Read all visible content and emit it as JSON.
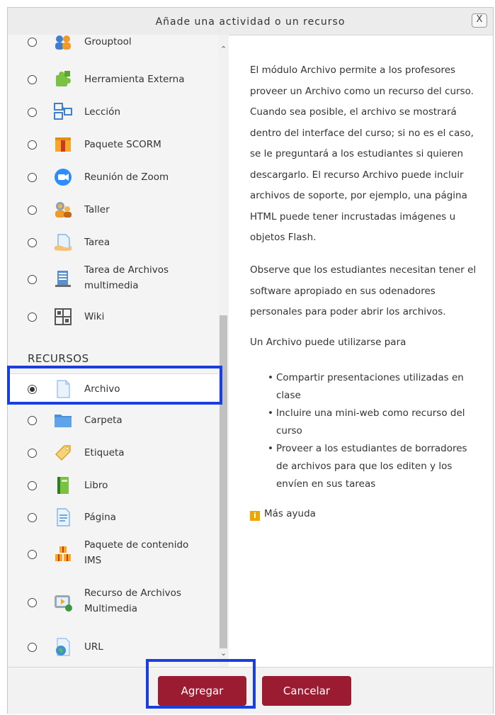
{
  "dialog": {
    "title": "Añade una actividad o un recurso",
    "close_label": "X"
  },
  "activities": [
    {
      "label": "Grouptool",
      "icon": "grouptool-icon"
    },
    {
      "label": "Herramienta Externa",
      "icon": "puzzle-icon"
    },
    {
      "label": "Lección",
      "icon": "lesson-icon"
    },
    {
      "label": "Paquete SCORM",
      "icon": "scorm-package-icon"
    },
    {
      "label": "Reunión de Zoom",
      "icon": "zoom-icon"
    },
    {
      "label": "Taller",
      "icon": "workshop-icon"
    },
    {
      "label": "Tarea",
      "icon": "assignment-icon"
    },
    {
      "label": "Tarea de Archivos multimedia",
      "icon": "media-assignment-icon"
    },
    {
      "label": "Wiki",
      "icon": "wiki-icon"
    }
  ],
  "resources_heading": "RECURSOS",
  "resources": [
    {
      "label": "Archivo",
      "icon": "file-icon",
      "selected": true
    },
    {
      "label": "Carpeta",
      "icon": "folder-icon"
    },
    {
      "label": "Etiqueta",
      "icon": "label-icon"
    },
    {
      "label": "Libro",
      "icon": "book-icon"
    },
    {
      "label": "Página",
      "icon": "page-icon"
    },
    {
      "label": "Paquete de contenido IMS",
      "icon": "ims-package-icon"
    },
    {
      "label": "Recurso de Archivos Multimedia",
      "icon": "media-resource-icon"
    },
    {
      "label": "URL",
      "icon": "url-globe-icon"
    }
  ],
  "description": {
    "p1": "El módulo Archivo permite a los profesores proveer un Archivo como un recurso del curso. Cuando sea posible, el archivo se mostrará dentro del interface del curso; si no es el caso, se le preguntará a los estudiantes si quieren descargarlo. El recurso Archivo puede incluir archivos de soporte, por ejemplo, una página HTML puede tener incrustadas imágenes u objetos Flash.",
    "p2": "Observe que los estudiantes necesitan tener el software apropiado en sus odenadores personales para poder abrir los archivos.",
    "p3": "Un Archivo puede utilizarse para",
    "bullets": [
      "Compartir presentaciones utilizadas en clase",
      "Incluire una mini-web como recurso del curso",
      "Proveer a los estudiantes de borradores de archivos para que los editen y los envíen en sus tareas"
    ],
    "help_label": "Más ayuda",
    "help_icon": "i"
  },
  "footer": {
    "add_label": "Agregar",
    "cancel_label": "Cancelar"
  },
  "colors": {
    "button": "#9b1c31",
    "highlight": "#1a3fe0"
  }
}
